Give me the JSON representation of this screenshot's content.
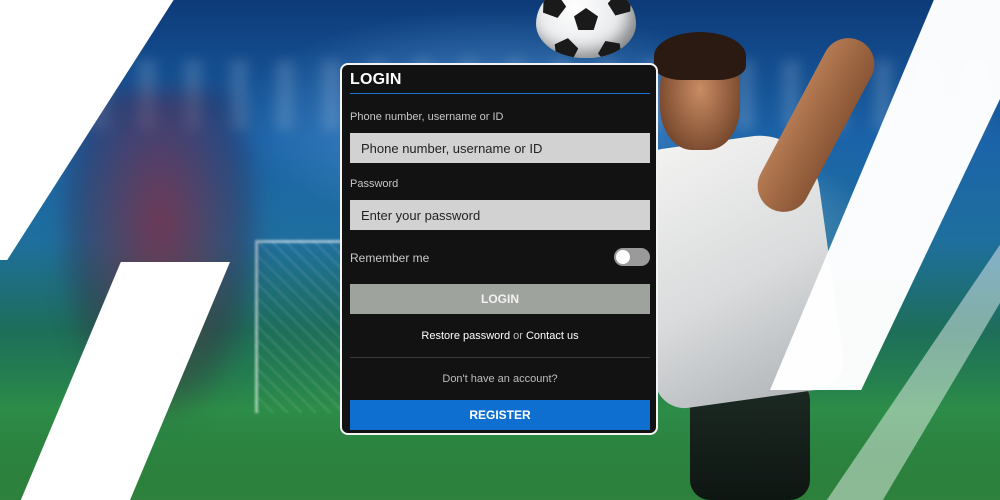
{
  "login": {
    "title": "LOGIN",
    "username_label": "Phone number, username or ID",
    "username_placeholder": "Phone number, username or ID",
    "password_label": "Password",
    "password_placeholder": "Enter your password",
    "remember_label": "Remember me",
    "remember_checked": false,
    "login_button": "LOGIN",
    "restore_link": "Restore password",
    "or_text": "or",
    "contact_link": "Contact us",
    "no_account_text": "Don't have an account?",
    "register_button": "REGISTER"
  },
  "colors": {
    "panel_bg": "#121212",
    "accent_blue": "#0f6fd0",
    "login_button_bg": "#9fa39d",
    "field_bg": "#d2d2d2"
  }
}
